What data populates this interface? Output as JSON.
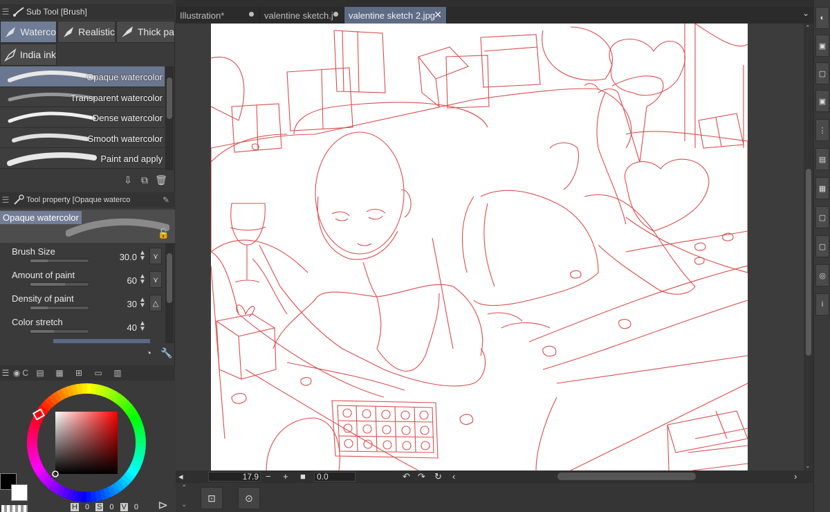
{
  "subtool_panel": {
    "title": "Sub Tool [Brush]",
    "tabs": [
      {
        "label": "Waterco",
        "icon": "brush-icon",
        "active": true
      },
      {
        "label": "Realistic",
        "icon": "brush-icon",
        "active": false
      },
      {
        "label": "Thick pa",
        "icon": "brush-icon",
        "active": false
      },
      {
        "label": "India ink",
        "icon": "brush-icon",
        "active": false
      }
    ],
    "brushes": [
      {
        "label": "Opaque watercolor",
        "selected": true
      },
      {
        "label": "Transparent watercolor",
        "selected": false
      },
      {
        "label": "Dense watercolor",
        "selected": false
      },
      {
        "label": "Smooth watercolor",
        "selected": false
      },
      {
        "label": "Paint and apply",
        "selected": false
      }
    ]
  },
  "tool_property": {
    "title": "Tool property [Opaque waterco",
    "preset_name": "Opaque watercolor",
    "properties": [
      {
        "label": "Brush Size",
        "value": "30.0",
        "fill": 0.3
      },
      {
        "label": "Amount of paint",
        "value": "60",
        "fill": 0.6
      },
      {
        "label": "Density of paint",
        "value": "30",
        "fill": 0.3
      },
      {
        "label": "Color stretch",
        "value": "40",
        "fill": 0.4
      }
    ]
  },
  "color_panel": {
    "tab_label": "C",
    "h_label": "H",
    "h_value": "0",
    "s_label": "S",
    "s_value": "0",
    "v_label": "V",
    "v_value": "0",
    "main_color": "#000000",
    "sub_color": "#ffffff",
    "wheel_marker_color": "#d42a2a"
  },
  "document_tabs": [
    {
      "label": "Illustration*",
      "active": false,
      "modified_dot": true
    },
    {
      "label": "valentine sketch.j",
      "active": false,
      "modified_dot": true
    },
    {
      "label": "valentine sketch 2.jpg",
      "active": true,
      "close": "✕"
    }
  ],
  "tabs_menu_icon": "chevron-down-icon",
  "status_bar": {
    "zoom": "17.9",
    "angle": "0.0"
  },
  "colors": {
    "accent": "#6b7790",
    "sketch_line": "#d94b4b"
  }
}
